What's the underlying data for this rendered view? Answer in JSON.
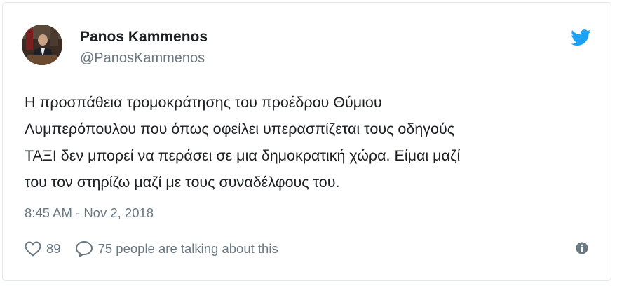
{
  "user": {
    "name": "Panos Kammenos",
    "handle": "@PanosKammenos",
    "avatar_icon": "profile-photo"
  },
  "tweet": {
    "lines": [
      "Η προσπάθεια τρομοκράτησης του προέδρου Θύμιου",
      "Λυμπερόπουλου που όπως οφείλει υπερασπίζεται τους οδηγούς",
      "ΤΑΞΙ δεν μπορεί να περάσει σε μια δημοκρατική χώρα. Είμαι μαζί",
      "του τον στηρίζω μαζί με τους συναδέλφους του."
    ],
    "timestamp": "8:45 AM - Nov 2, 2018"
  },
  "actions": {
    "like_icon": "heart-icon",
    "like_count": "89",
    "reply_icon": "speech-bubble-icon",
    "reply_label": "75 people are talking about this",
    "info_icon": "info-icon"
  },
  "colors": {
    "brand": "#1da1f2",
    "text": "#1c2022",
    "muted": "#697882",
    "border": "#e1e8ed"
  }
}
